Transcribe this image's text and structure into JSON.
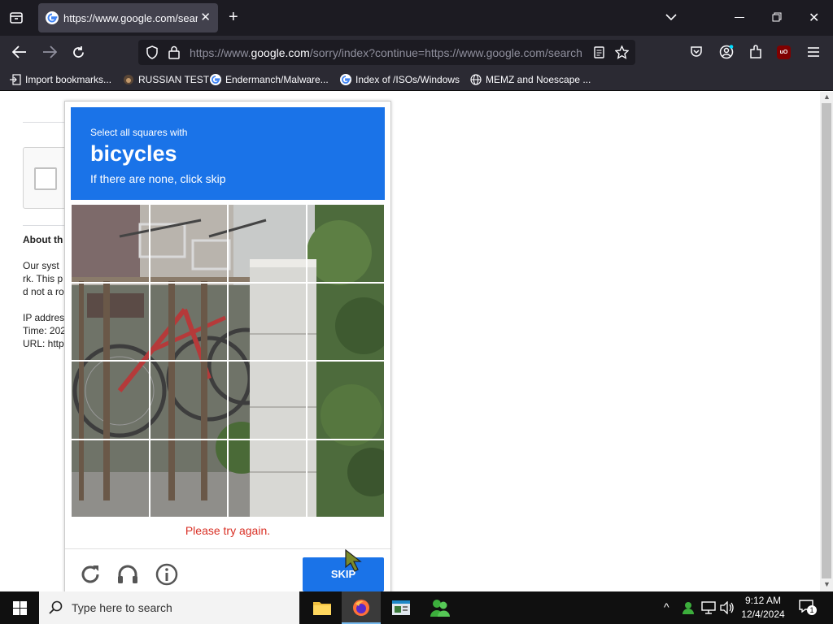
{
  "browser": {
    "tab_title": "https://www.google.com/search",
    "url_prefix": "https://www.",
    "url_domain": "google.com",
    "url_rest": "/sorry/index?continue=https://www.google.com/search",
    "bookmarks": [
      "Import bookmarks...",
      "RUSSIAN TEST",
      "Endermanch/Malware...",
      "Index of /ISOs/Windows",
      "MEMZ and Noescape ..."
    ],
    "ublock_label": "uO"
  },
  "page": {
    "about_heading": "About th",
    "body_lines": [
      "Our syst",
      "rk. This p",
      "d not a ro"
    ],
    "ip_label": "IP addres",
    "time_label": "Time: 202",
    "url_label": "URL: http"
  },
  "captcha": {
    "instruction_small": "Select all squares with",
    "target_word": "bicycles",
    "instruction_sub": "If there are none, click skip",
    "error_text": "Please try again.",
    "skip_label": "SKIP"
  },
  "taskbar": {
    "search_placeholder": "Type here to search",
    "time": "9:12 AM",
    "date": "12/4/2024",
    "notification_count": "1"
  },
  "colors": {
    "accent": "#1a73e8",
    "error": "#d93025",
    "browser_dark": "#1c1b22"
  }
}
